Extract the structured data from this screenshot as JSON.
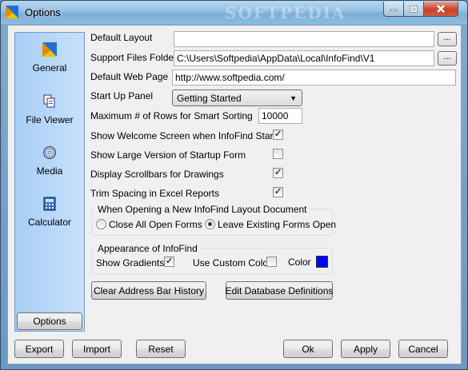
{
  "window": {
    "title": "Options",
    "watermark": "SOFTPEDIA"
  },
  "nav": {
    "items": [
      {
        "label": "General",
        "icon": "infofind-logo-icon"
      },
      {
        "label": "File Viewer",
        "icon": "file-viewer-icon"
      },
      {
        "label": "Media",
        "icon": "media-disc-icon"
      },
      {
        "label": "Calculator",
        "icon": "calculator-icon"
      }
    ],
    "options_button": "Options"
  },
  "form": {
    "default_layout": {
      "label": "Default Layout",
      "value": ""
    },
    "support_folder": {
      "label": "Support Files Folder",
      "value": "C:\\Users\\Softpedia\\AppData\\Local\\InfoFind\\V1"
    },
    "web_page": {
      "label": "Default Web Page",
      "value": "http://www.softpedia.com/"
    },
    "start_up": {
      "label": "Start Up Panel",
      "value": "Getting Started"
    },
    "max_rows": {
      "label": "Maximum # of Rows for Smart Sorting",
      "value": "10000"
    },
    "ellipsis": "...",
    "checks": [
      {
        "label": "Show Welcome Screen when InfoFind Starts",
        "checked": true
      },
      {
        "label": "Show Large Version of Startup Form",
        "checked": false
      },
      {
        "label": "Display Scrollbars for Drawings",
        "checked": true
      },
      {
        "label": "Trim Spacing in Excel Reports",
        "checked": true
      }
    ],
    "layout_group": {
      "title": "When Opening a New InfoFind Layout Document",
      "close_all": "Close All Open Forms",
      "leave_existing": "Leave Existing Forms Open",
      "selected": "leave_existing"
    },
    "appearance_group": {
      "title": "Appearance of InfoFind",
      "show_gradients": "Show Gradients",
      "show_gradients_checked": true,
      "use_custom_color": "Use Custom Color",
      "use_custom_color_checked": false,
      "color_label": "Color",
      "color_value": "#0000ff"
    },
    "clear_history_button": "Clear Address Bar History",
    "edit_db_button": "Edit Database Definitions"
  },
  "footer": {
    "export": "Export",
    "import": "Import",
    "reset": "Reset",
    "ok": "Ok",
    "apply": "Apply",
    "cancel": "Cancel"
  }
}
